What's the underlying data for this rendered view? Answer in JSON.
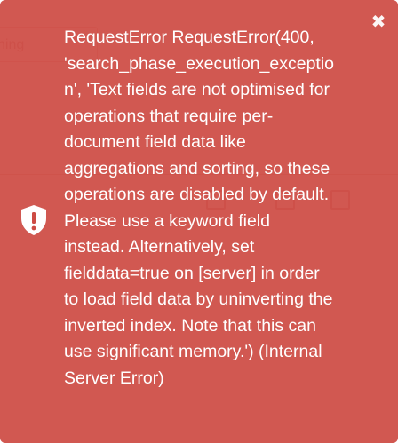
{
  "background": {
    "search_partial_text": "hing"
  },
  "toast": {
    "type": "error",
    "color": "#cd4b44",
    "icon": "shield-alert-icon",
    "close_symbol": "✖",
    "message": "RequestError RequestError(400,\n'search_phase_execution_exceptio\nn', 'Text fields are not optimised for\noperations that require per-\ndocument field data like\naggregations and sorting, so these\noperations are disabled by default.\nPlease use a keyword field\ninstead. Alternatively, set\nfielddata=true on [server] in order\nto load field data by uninverting the\ninverted index. Note that this can\nuse significant memory.') (Internal\nServer Error)"
  }
}
